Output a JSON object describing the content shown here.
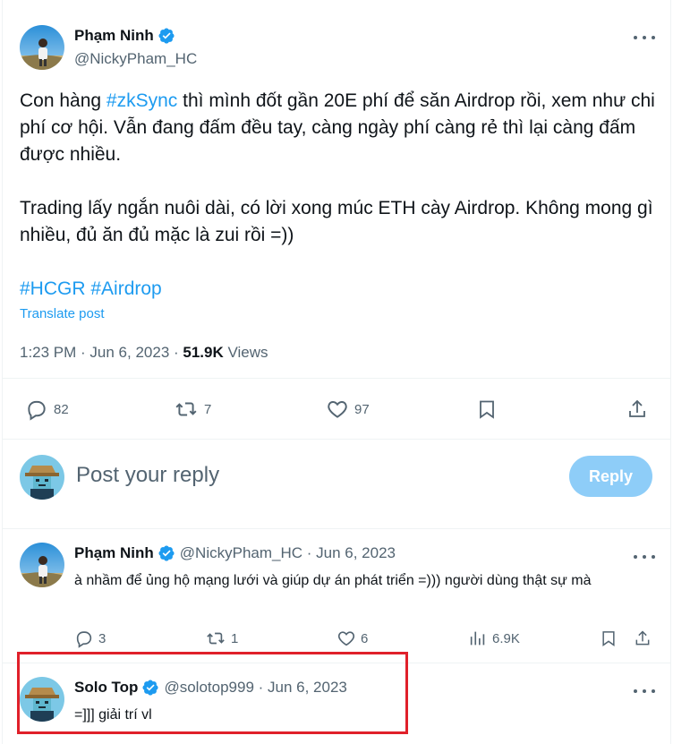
{
  "main_tweet": {
    "author_name": "Phạm Ninh",
    "author_handle": "@NickyPham_HC",
    "text_part1": "Con hàng ",
    "hashtag1": "#zkSync",
    "text_part2": " thì mình đốt gần 20E phí để săn Airdrop rồi, xem như chi phí cơ hội. Vẫn đang đấm đều tay, càng ngày phí càng rẻ thì lại càng đấm được nhiều.",
    "paragraph2": "Trading lấy ngắn nuôi dài, có lời xong múc ETH cày Airdrop. Không mong gì nhiều, đủ ăn đủ mặc là zui rồi =))",
    "hashtag2": "#HCGR",
    "hashtag3": "#Airdrop",
    "translate_label": "Translate post",
    "time": "1:23 PM · Jun 6, 2023 · ",
    "views_count": "51.9K",
    "views_label": " Views",
    "replies": "82",
    "reposts": "7",
    "likes": "97"
  },
  "composer": {
    "placeholder": "Post your reply",
    "reply_button": "Reply"
  },
  "replies": [
    {
      "author_name": "Phạm Ninh",
      "meta": "@NickyPham_HC · Jun 6, 2023",
      "text": "à nhầm để ủng hộ mạng lưới và giúp dự án phát triển =))) người dùng thật sự mà",
      "replies": "3",
      "reposts": "1",
      "likes": "6",
      "views": "6.9K"
    },
    {
      "author_name": "Solo Top",
      "meta": "@solotop999 · Jun 6, 2023",
      "text": "=]]] giải trí vl"
    }
  ],
  "colors": {
    "accent": "#1d9bf0",
    "secondary_text": "#536471",
    "reply_button_bg": "#8ecdf8",
    "highlight_border": "#e0202a"
  },
  "icons": {
    "verified": "verified-badge-icon",
    "reply": "reply-icon",
    "repost": "repost-icon",
    "like": "heart-icon",
    "bookmark": "bookmark-icon",
    "share": "share-icon",
    "views": "views-icon",
    "more": "more-icon"
  }
}
